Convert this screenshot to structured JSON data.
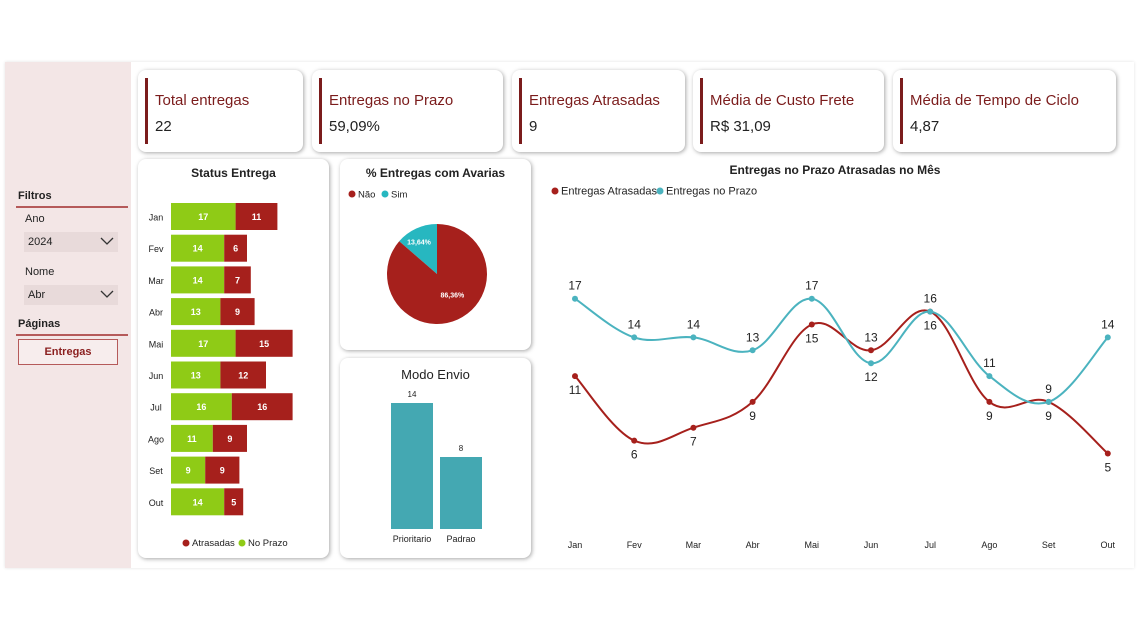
{
  "sidebar": {
    "filters_title": "Filtros",
    "year_label": "Ano",
    "year_value": "2024",
    "name_label": "Nome",
    "name_value": "Abr",
    "pages_title": "Páginas",
    "page_button": "Entregas"
  },
  "kpis": [
    {
      "title": "Total entregas",
      "value": "22"
    },
    {
      "title": "Entregas no Prazo",
      "value": "59,09%"
    },
    {
      "title": "Entregas Atrasadas",
      "value": "9"
    },
    {
      "title": "Média de Custo Frete",
      "value": "R$ 31,09"
    },
    {
      "title": "Média de Tempo de Ciclo",
      "value": "4,87"
    }
  ],
  "colors": {
    "atrasadas": "#a6201c",
    "no_prazo": "#8fcb16",
    "sim": "#27b7c0",
    "modo_envio": "#44a8b2",
    "line_prazo": "#4bb3bf",
    "accent": "#7b1c1c"
  },
  "chart_data": [
    {
      "type": "bar",
      "orientation": "horizontal",
      "stacked": true,
      "title": "Status Entrega",
      "categories": [
        "Jan",
        "Fev",
        "Mar",
        "Abr",
        "Mai",
        "Jun",
        "Jul",
        "Ago",
        "Set",
        "Out"
      ],
      "series": [
        {
          "name": "No Prazo",
          "values": [
            17,
            14,
            14,
            13,
            17,
            13,
            16,
            11,
            9,
            14
          ]
        },
        {
          "name": "Atrasadas",
          "values": [
            11,
            6,
            7,
            9,
            15,
            12,
            16,
            9,
            9,
            5
          ]
        }
      ],
      "legend": [
        "Atrasadas",
        "No Prazo"
      ],
      "legend_position": "bottom"
    },
    {
      "type": "pie",
      "title": "% Entregas com Avarias",
      "slices": [
        {
          "name": "Não",
          "value": 86.36,
          "label": "86,36%"
        },
        {
          "name": "Sim",
          "value": 13.64,
          "label": "13,64%"
        }
      ],
      "legend_position": "top-left"
    },
    {
      "type": "bar",
      "title": "Modo Envio",
      "categories": [
        "Prioritario",
        "Padrao"
      ],
      "values": [
        14,
        8
      ]
    },
    {
      "type": "line",
      "title": "Entregas no Prazo Atrasadas no Mês",
      "categories": [
        "Jan",
        "Fev",
        "Mar",
        "Abr",
        "Mai",
        "Jun",
        "Jul",
        "Ago",
        "Set",
        "Out"
      ],
      "series": [
        {
          "name": "Entregas Atrasadas",
          "values": [
            11,
            6,
            7,
            9,
            15,
            13,
            16,
            9,
            9,
            5
          ]
        },
        {
          "name": "Entregas no Prazo",
          "values": [
            17,
            14,
            14,
            13,
            17,
            12,
            16,
            11,
            9,
            14
          ]
        }
      ],
      "legend_position": "top-left"
    }
  ]
}
